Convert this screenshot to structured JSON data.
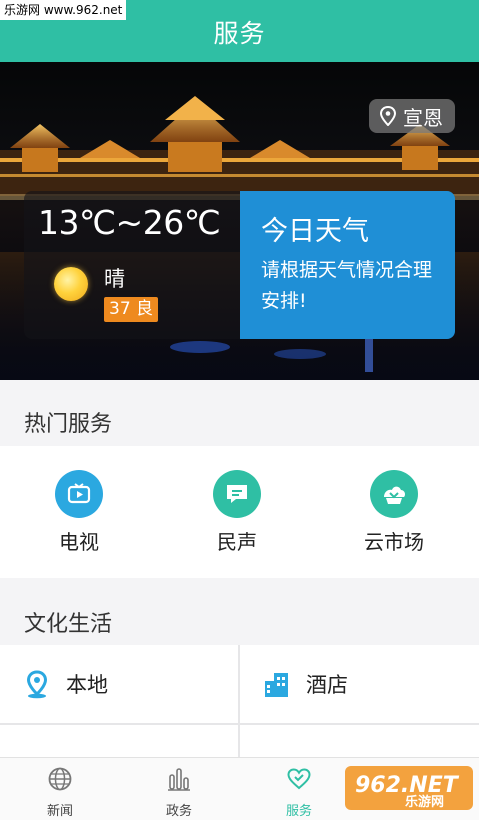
{
  "watermark_top": "乐游网 www.962.net",
  "header": {
    "title": "服务"
  },
  "weather": {
    "location": "宣恩",
    "temperature": "13℃~26℃",
    "condition": "晴",
    "aqi": "37 良",
    "card_title": "今日天气",
    "card_desc": "请根据天气情况合理安排!"
  },
  "hot_services": {
    "title": "热门服务",
    "items": [
      {
        "label": "电视",
        "icon": "tv-icon",
        "color": "#2ba8e0"
      },
      {
        "label": "民声",
        "icon": "chat-icon",
        "color": "#2fbfa4"
      },
      {
        "label": "云市场",
        "icon": "market-icon",
        "color": "#2fbfa4"
      }
    ]
  },
  "culture": {
    "title": "文化生活",
    "items": [
      {
        "label": "本地",
        "icon": "location-icon"
      },
      {
        "label": "酒店",
        "icon": "hotel-icon"
      }
    ]
  },
  "tabs": [
    {
      "label": "新闻",
      "icon": "globe-icon"
    },
    {
      "label": "政务",
      "icon": "bar-chart-icon"
    },
    {
      "label": "服务",
      "icon": "heart-icon",
      "active": true
    }
  ],
  "watermark_bottom": {
    "main": "962.NET",
    "sub": "乐游网"
  },
  "colors": {
    "primary": "#2fbfa4",
    "weather_blue": "#1f8fd6",
    "aqi_orange": "#ee8a1f"
  }
}
